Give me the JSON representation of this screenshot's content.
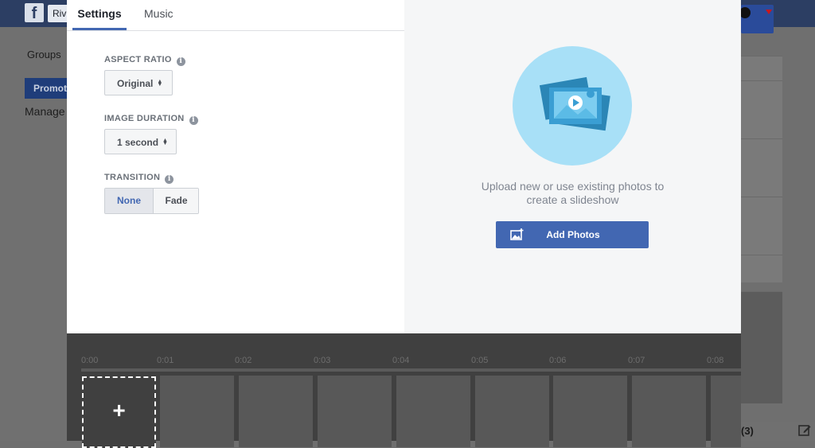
{
  "background": {
    "fb_logo": "f",
    "profile_chip": "Riv",
    "groups_text": "Groups",
    "promote_label": "Promote",
    "manage_text": "Manage",
    "chat_count": "(3)"
  },
  "tabs": [
    {
      "label": "Settings",
      "active": true
    },
    {
      "label": "Music",
      "active": false
    }
  ],
  "settings": {
    "aspect_ratio": {
      "label": "ASPECT RATIO",
      "value": "Original"
    },
    "image_duration": {
      "label": "IMAGE DURATION",
      "value": "1 second"
    },
    "transition": {
      "label": "TRANSITION",
      "options": [
        "None",
        "Fade"
      ],
      "selected": "None"
    }
  },
  "upload": {
    "line1": "Upload new or use existing photos to",
    "line2": "create a slideshow",
    "button_label": "Add Photos"
  },
  "timeline": {
    "ticks": [
      "0:00",
      "0:01",
      "0:02",
      "0:03",
      "0:04",
      "0:05",
      "0:06",
      "0:07",
      "0:08"
    ],
    "add_symbol": "+"
  },
  "colors": {
    "accent": "#4267b2",
    "illustration_bg": "#a8e0f7"
  },
  "icons": {
    "info": "info-icon",
    "add_photo": "add-photo-icon",
    "compose": "compose-icon"
  }
}
